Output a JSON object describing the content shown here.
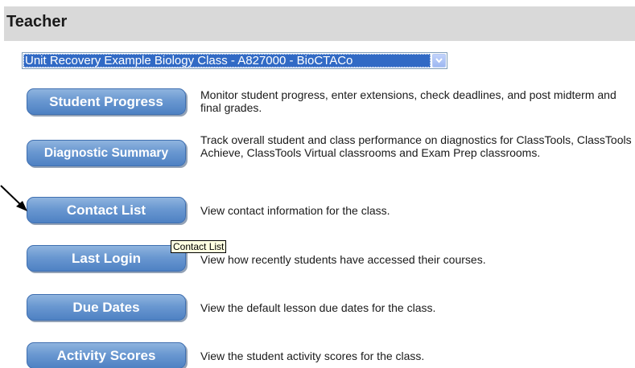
{
  "header": {
    "title": "Teacher"
  },
  "class_select": {
    "value": "Unit Recovery Example Biology Class - A827000 - BioCTACo"
  },
  "buttons": [
    {
      "label": "Student Progress",
      "description": "Monitor student progress, enter extensions, check deadlines, and post midterm and final grades."
    },
    {
      "label": "Diagnostic Summary",
      "description": "Track overall student and class performance on diagnostics for ClassTools, ClassTools Achieve, ClassTools Virtual classrooms and Exam Prep classrooms."
    },
    {
      "label": "Contact List",
      "description": "View contact information for the class."
    },
    {
      "label": "Last Login",
      "description": "View how recently students have accessed their courses."
    },
    {
      "label": "Due Dates",
      "description": "View the default lesson due dates for the class."
    },
    {
      "label": "Activity Scores",
      "description": "View the student activity scores for the class."
    }
  ],
  "tooltip": {
    "text": "Contact List"
  },
  "icons": {
    "pointer": "pointer-arrow-icon",
    "dropdown": "chevron-down-icon"
  }
}
